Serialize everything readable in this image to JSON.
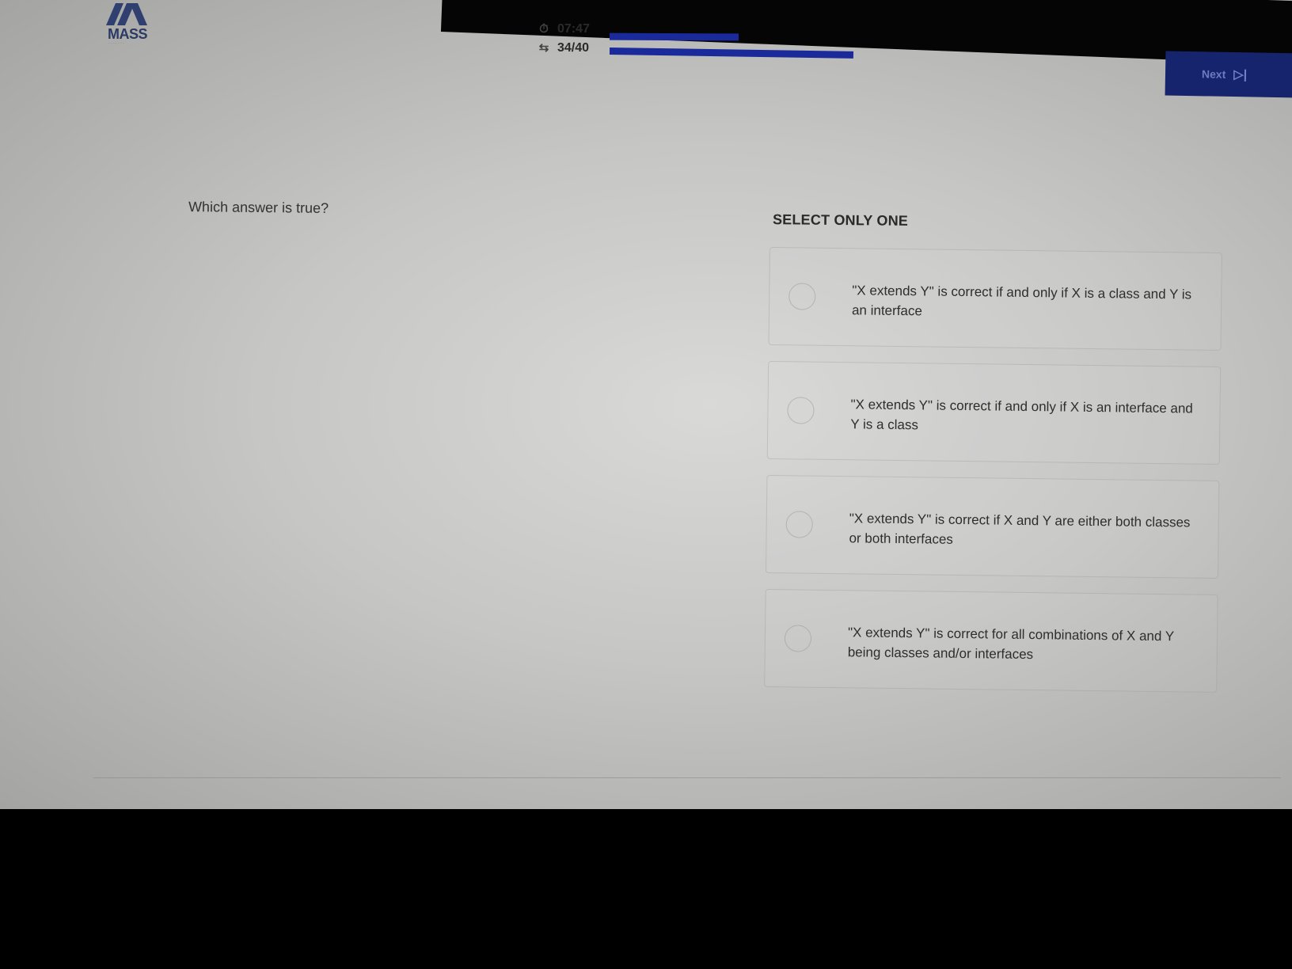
{
  "brand": {
    "logo_text": "MASS",
    "accent_color": "#1b2a9a"
  },
  "header": {
    "timer": {
      "icon": "stopwatch-icon",
      "value": "07:47",
      "progress": 0.45
    },
    "question_progress": {
      "icon": "repeat-icon",
      "value": "34/40",
      "progress": 0.85
    },
    "next_button": {
      "label": "Next",
      "icon": "skip-next-icon"
    }
  },
  "question": {
    "prompt": "Which answer is true?",
    "instruction": "SELECT ONLY ONE",
    "options": [
      {
        "text": "\"X extends Y\" is correct if and only if X is a class and Y is an interface",
        "selected": false
      },
      {
        "text": "\"X extends Y\" is correct if and only if X is an interface and Y is a class",
        "selected": false
      },
      {
        "text": "\"X extends Y\" is correct if X and Y are either both classes or both interfaces",
        "selected": false
      },
      {
        "text": "\"X extends Y\" is correct for all combinations of X and Y being classes and/or interfaces",
        "selected": false
      }
    ]
  }
}
